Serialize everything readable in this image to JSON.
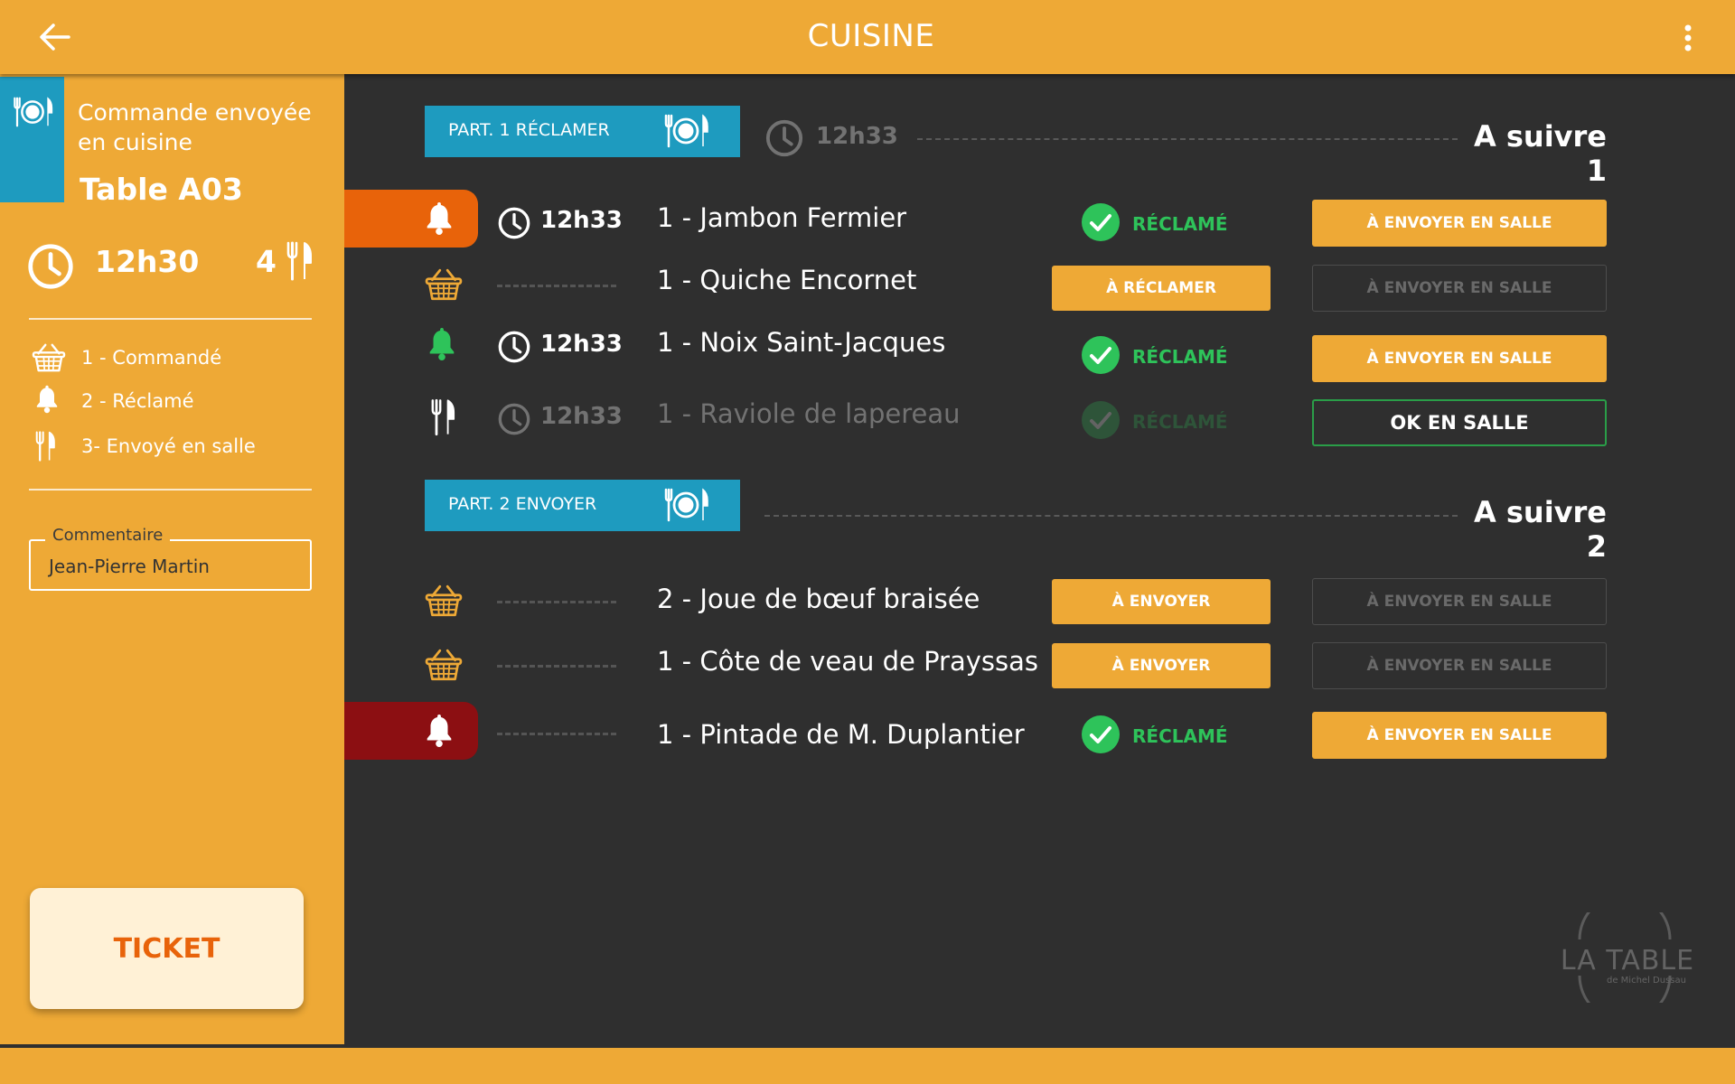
{
  "header": {
    "title": "CUISINE"
  },
  "sidebar": {
    "status": "Commande envoyée en cuisine",
    "table": "Table A03",
    "time": "12h30",
    "covers": "4",
    "legend": [
      {
        "icon": "basket-icon",
        "label": "1 - Commandé"
      },
      {
        "icon": "bell-icon",
        "label": "2 - Réclamé"
      },
      {
        "icon": "cutlery-icon",
        "label": "3- Envoyé en salle"
      }
    ],
    "comment_label": "Commentaire",
    "comment_value": "Jean-Pierre Martin",
    "ticket_label": "TICKET"
  },
  "parts": [
    {
      "label": "PART. 1  RÉCLAMER",
      "time": "12h33",
      "next": "A suivre 1"
    },
    {
      "label": "PART. 2  ENVOYER",
      "next": "A suivre 2"
    }
  ],
  "rows": [
    {
      "dish": "1 - Jambon Fermier",
      "time": "12h33",
      "status": "RÉCLAMÉ",
      "action": "À ENVOYER EN SALLE",
      "tag_color": "#e8630a"
    },
    {
      "dish": "1 - Quiche Encornet",
      "kitchen_action": "À RÉCLAMER",
      "action": "À ENVOYER EN SALLE"
    },
    {
      "dish": "1 - Noix Saint-Jacques",
      "time": "12h33",
      "status": "RÉCLAMÉ",
      "action": "À ENVOYER EN SALLE"
    },
    {
      "dish": "1 - Raviole de lapereau",
      "time": "12h33",
      "status": "RÉCLAMÉ",
      "action": "OK EN SALLE"
    },
    {
      "dish": "2 - Joue de bœuf braisée",
      "kitchen_action": "À ENVOYER",
      "action": "À ENVOYER EN SALLE"
    },
    {
      "dish": "1 - Côte de veau de Prayssas",
      "kitchen_action": "À ENVOYER",
      "action": "À ENVOYER EN SALLE"
    },
    {
      "dish": "1 - Pintade de M. Duplantier",
      "status": "RÉCLAMÉ",
      "action": "À ENVOYER EN SALLE",
      "tag_color": "#8c0f12"
    }
  ],
  "logo": {
    "name": "LA TABLE",
    "subtitle": "de Michel Dussau"
  },
  "colors": {
    "accent": "#eea936",
    "blue": "#1e9bbf",
    "green": "#2ec35a",
    "background": "#2f2f2f"
  }
}
